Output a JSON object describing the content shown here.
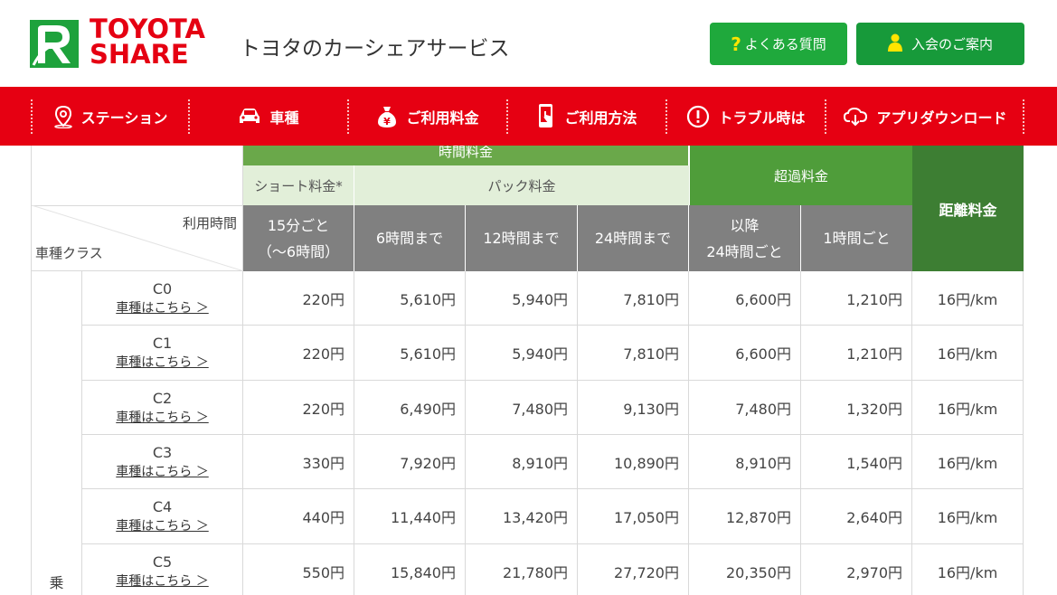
{
  "brand": {
    "logo_line1": "TOYOTA",
    "logo_line2": "SHARE",
    "tagline": "トヨタのカーシェアサービス",
    "red": "#e60012",
    "green": "#1fa93c"
  },
  "header_buttons": {
    "faq": {
      "icon": "question-icon",
      "label": "よくある質問"
    },
    "join": {
      "icon": "person-icon",
      "label": "入会のご案内"
    }
  },
  "nav": [
    {
      "icon": "location-pin-icon",
      "label": "ステーション"
    },
    {
      "icon": "car-icon",
      "label": "車種"
    },
    {
      "icon": "money-bag-icon",
      "label": "ご利用料金"
    },
    {
      "icon": "smartphone-icon",
      "label": "ご利用方法"
    },
    {
      "icon": "alert-icon",
      "label": "トラブル時は"
    },
    {
      "icon": "cloud-download-icon",
      "label": "アプリダウンロード"
    }
  ],
  "price_table": {
    "group_time_fee": "時間料金",
    "short_fee": "ショート料金*",
    "pack_fee": "パック料金",
    "overage_fee": "超過料金",
    "distance_fee": "距離料金",
    "usage_time_label": "利用時間",
    "class_label": "車種クラス",
    "col_15min_line1": "15分ごと",
    "col_15min_line2": "（〜6時間）",
    "col_6h": "6時間まで",
    "col_12h": "12時間まで",
    "col_24h": "24時間まで",
    "col_after_line1": "以降",
    "col_after_line2": "24時間ごと",
    "col_per_hour": "1時間ごと",
    "category_partial": "乗",
    "link_text": "車種はこちら ＞",
    "rows": [
      {
        "class": "C0",
        "v": [
          "220円",
          "5,610円",
          "5,940円",
          "7,810円",
          "6,600円",
          "1,210円",
          "16円/km"
        ]
      },
      {
        "class": "C1",
        "v": [
          "220円",
          "5,610円",
          "5,940円",
          "7,810円",
          "6,600円",
          "1,210円",
          "16円/km"
        ]
      },
      {
        "class": "C2",
        "v": [
          "220円",
          "6,490円",
          "7,480円",
          "9,130円",
          "7,480円",
          "1,320円",
          "16円/km"
        ]
      },
      {
        "class": "C3",
        "v": [
          "330円",
          "7,920円",
          "8,910円",
          "10,890円",
          "8,910円",
          "1,540円",
          "16円/km"
        ]
      },
      {
        "class": "C4",
        "v": [
          "440円",
          "11,440円",
          "13,420円",
          "17,050円",
          "12,870円",
          "2,640円",
          "16円/km"
        ]
      },
      {
        "class": "C5",
        "v": [
          "550円",
          "15,840円",
          "21,780円",
          "27,720円",
          "20,350円",
          "2,970円",
          "16円/km"
        ]
      }
    ]
  }
}
